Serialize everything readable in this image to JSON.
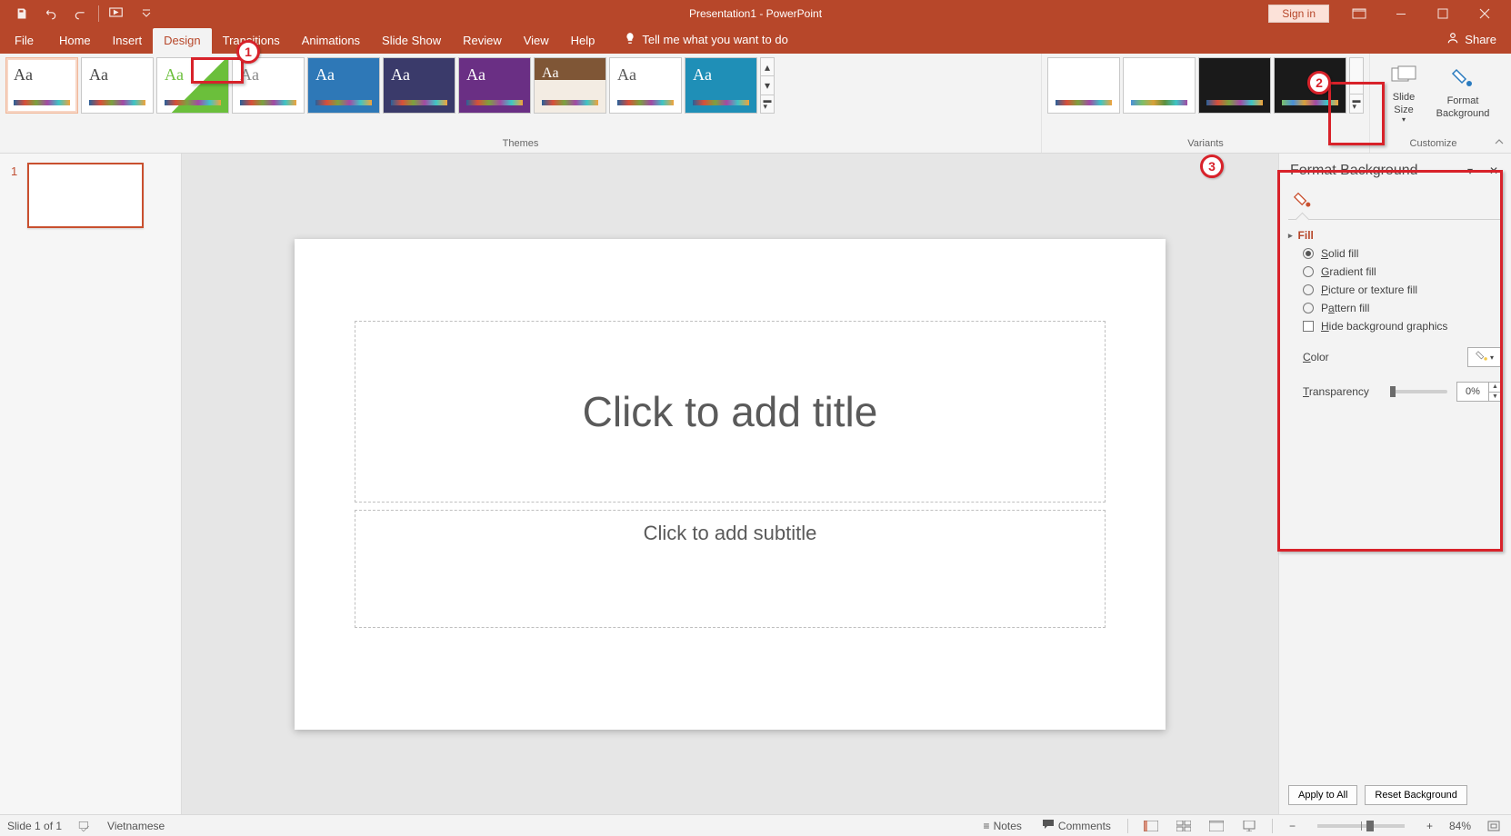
{
  "app": {
    "title": "Presentation1 - PowerPoint",
    "signin": "Sign in"
  },
  "tabs": {
    "file": "File",
    "home": "Home",
    "insert": "Insert",
    "design": "Design",
    "transitions": "Transitions",
    "animations": "Animations",
    "slideshow": "Slide Show",
    "review": "Review",
    "view": "View",
    "help": "Help",
    "tellme": "Tell me what you want to do",
    "share": "Share"
  },
  "ribbon": {
    "themes": {
      "label": "Themes",
      "aa": "Aa"
    },
    "variants": {
      "label": "Variants"
    },
    "customize": {
      "label": "Customize",
      "slide_size": "Slide\nSize",
      "format_bg": "Format\nBackground"
    }
  },
  "slidesnav": {
    "num1": "1"
  },
  "slide": {
    "title_ph": "Click to add title",
    "subtitle_ph": "Click to add subtitle"
  },
  "sidepanel": {
    "title": "Format Background",
    "section_fill": "Fill",
    "opt_solid": "Solid fill",
    "opt_gradient": "Gradient fill",
    "opt_picture": "Picture or texture fill",
    "opt_pattern": "Pattern fill",
    "chk_hide": "Hide background graphics",
    "lbl_color": "Color",
    "lbl_transparency": "Transparency",
    "transparency_val": "0%",
    "apply_all": "Apply to All",
    "reset_bg": "Reset Background"
  },
  "statusbar": {
    "slide": "Slide 1 of 1",
    "lang": "Vietnamese",
    "notes": "Notes",
    "comments": "Comments",
    "zoom": "84%"
  },
  "annotations": {
    "a1": "1",
    "a2": "2",
    "a3": "3"
  }
}
